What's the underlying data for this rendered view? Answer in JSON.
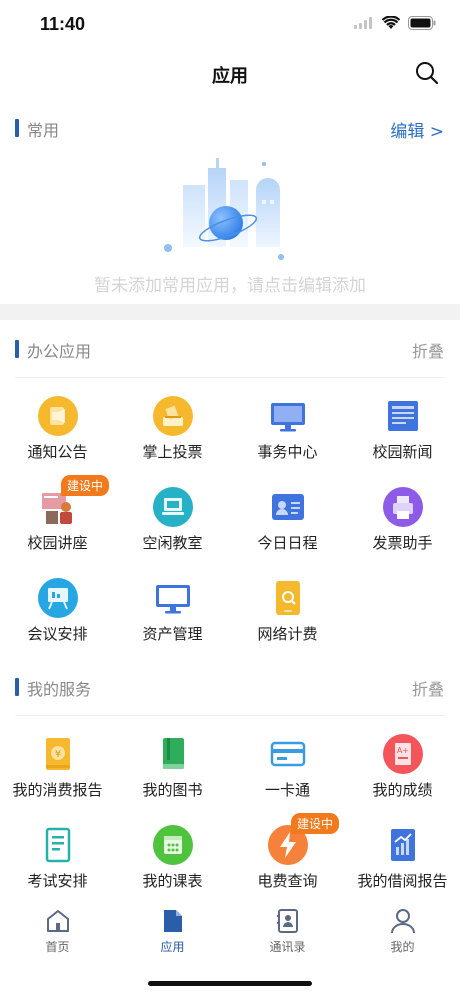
{
  "status": {
    "time": "11:40"
  },
  "nav": {
    "title": "应用"
  },
  "common": {
    "title": "常用",
    "action": "编辑 >",
    "empty_text": "暂未添加常用应用，请点击编辑添加"
  },
  "office": {
    "title": "办公应用",
    "action": "折叠",
    "items": [
      {
        "label": "通知公告",
        "icon": "megaphone-icon"
      },
      {
        "label": "掌上投票",
        "icon": "ballot-icon"
      },
      {
        "label": "事务中心",
        "icon": "monitor-icon"
      },
      {
        "label": "校园新闻",
        "icon": "newspaper-icon"
      },
      {
        "label": "校园讲座",
        "icon": "lecture-icon",
        "badge": "建设中"
      },
      {
        "label": "空闲教室",
        "icon": "laptop-icon"
      },
      {
        "label": "今日日程",
        "icon": "id-card-icon"
      },
      {
        "label": "发票助手",
        "icon": "printer-icon"
      },
      {
        "label": "会议安排",
        "icon": "easel-icon"
      },
      {
        "label": "资产管理",
        "icon": "desktop-icon"
      },
      {
        "label": "网络计费",
        "icon": "phone-icon"
      }
    ]
  },
  "services": {
    "title": "我的服务",
    "action": "折叠",
    "items": [
      {
        "label": "我的消费报告",
        "icon": "yuan-book-icon"
      },
      {
        "label": "我的图书",
        "icon": "book-icon"
      },
      {
        "label": "一卡通",
        "icon": "card-icon"
      },
      {
        "label": "我的成绩",
        "icon": "grade-icon"
      },
      {
        "label": "考试安排",
        "icon": "exam-doc-icon"
      },
      {
        "label": "我的课表",
        "icon": "calendar-icon"
      },
      {
        "label": "电费查询",
        "icon": "lightning-icon",
        "badge": "建设中"
      },
      {
        "label": "我的借阅报告",
        "icon": "chart-book-icon"
      }
    ]
  },
  "tabbar": {
    "items": [
      {
        "label": "首页",
        "icon": "home-icon"
      },
      {
        "label": "应用",
        "icon": "apps-doc-icon",
        "active": true
      },
      {
        "label": "通讯录",
        "icon": "contacts-icon"
      },
      {
        "label": "我的",
        "icon": "profile-icon"
      }
    ]
  }
}
